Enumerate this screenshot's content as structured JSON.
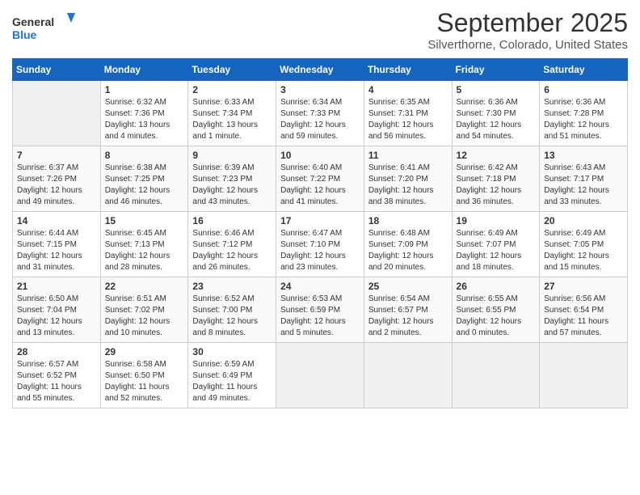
{
  "header": {
    "logo_line1": "General",
    "logo_line2": "Blue",
    "month": "September 2025",
    "location": "Silverthorne, Colorado, United States"
  },
  "weekdays": [
    "Sunday",
    "Monday",
    "Tuesday",
    "Wednesday",
    "Thursday",
    "Friday",
    "Saturday"
  ],
  "weeks": [
    [
      {
        "day": "",
        "sunrise": "",
        "sunset": "",
        "daylight": ""
      },
      {
        "day": "1",
        "sunrise": "Sunrise: 6:32 AM",
        "sunset": "Sunset: 7:36 PM",
        "daylight": "Daylight: 13 hours and 4 minutes."
      },
      {
        "day": "2",
        "sunrise": "Sunrise: 6:33 AM",
        "sunset": "Sunset: 7:34 PM",
        "daylight": "Daylight: 13 hours and 1 minute."
      },
      {
        "day": "3",
        "sunrise": "Sunrise: 6:34 AM",
        "sunset": "Sunset: 7:33 PM",
        "daylight": "Daylight: 12 hours and 59 minutes."
      },
      {
        "day": "4",
        "sunrise": "Sunrise: 6:35 AM",
        "sunset": "Sunset: 7:31 PM",
        "daylight": "Daylight: 12 hours and 56 minutes."
      },
      {
        "day": "5",
        "sunrise": "Sunrise: 6:36 AM",
        "sunset": "Sunset: 7:30 PM",
        "daylight": "Daylight: 12 hours and 54 minutes."
      },
      {
        "day": "6",
        "sunrise": "Sunrise: 6:36 AM",
        "sunset": "Sunset: 7:28 PM",
        "daylight": "Daylight: 12 hours and 51 minutes."
      }
    ],
    [
      {
        "day": "7",
        "sunrise": "Sunrise: 6:37 AM",
        "sunset": "Sunset: 7:26 PM",
        "daylight": "Daylight: 12 hours and 49 minutes."
      },
      {
        "day": "8",
        "sunrise": "Sunrise: 6:38 AM",
        "sunset": "Sunset: 7:25 PM",
        "daylight": "Daylight: 12 hours and 46 minutes."
      },
      {
        "day": "9",
        "sunrise": "Sunrise: 6:39 AM",
        "sunset": "Sunset: 7:23 PM",
        "daylight": "Daylight: 12 hours and 43 minutes."
      },
      {
        "day": "10",
        "sunrise": "Sunrise: 6:40 AM",
        "sunset": "Sunset: 7:22 PM",
        "daylight": "Daylight: 12 hours and 41 minutes."
      },
      {
        "day": "11",
        "sunrise": "Sunrise: 6:41 AM",
        "sunset": "Sunset: 7:20 PM",
        "daylight": "Daylight: 12 hours and 38 minutes."
      },
      {
        "day": "12",
        "sunrise": "Sunrise: 6:42 AM",
        "sunset": "Sunset: 7:18 PM",
        "daylight": "Daylight: 12 hours and 36 minutes."
      },
      {
        "day": "13",
        "sunrise": "Sunrise: 6:43 AM",
        "sunset": "Sunset: 7:17 PM",
        "daylight": "Daylight: 12 hours and 33 minutes."
      }
    ],
    [
      {
        "day": "14",
        "sunrise": "Sunrise: 6:44 AM",
        "sunset": "Sunset: 7:15 PM",
        "daylight": "Daylight: 12 hours and 31 minutes."
      },
      {
        "day": "15",
        "sunrise": "Sunrise: 6:45 AM",
        "sunset": "Sunset: 7:13 PM",
        "daylight": "Daylight: 12 hours and 28 minutes."
      },
      {
        "day": "16",
        "sunrise": "Sunrise: 6:46 AM",
        "sunset": "Sunset: 7:12 PM",
        "daylight": "Daylight: 12 hours and 26 minutes."
      },
      {
        "day": "17",
        "sunrise": "Sunrise: 6:47 AM",
        "sunset": "Sunset: 7:10 PM",
        "daylight": "Daylight: 12 hours and 23 minutes."
      },
      {
        "day": "18",
        "sunrise": "Sunrise: 6:48 AM",
        "sunset": "Sunset: 7:09 PM",
        "daylight": "Daylight: 12 hours and 20 minutes."
      },
      {
        "day": "19",
        "sunrise": "Sunrise: 6:49 AM",
        "sunset": "Sunset: 7:07 PM",
        "daylight": "Daylight: 12 hours and 18 minutes."
      },
      {
        "day": "20",
        "sunrise": "Sunrise: 6:49 AM",
        "sunset": "Sunset: 7:05 PM",
        "daylight": "Daylight: 12 hours and 15 minutes."
      }
    ],
    [
      {
        "day": "21",
        "sunrise": "Sunrise: 6:50 AM",
        "sunset": "Sunset: 7:04 PM",
        "daylight": "Daylight: 12 hours and 13 minutes."
      },
      {
        "day": "22",
        "sunrise": "Sunrise: 6:51 AM",
        "sunset": "Sunset: 7:02 PM",
        "daylight": "Daylight: 12 hours and 10 minutes."
      },
      {
        "day": "23",
        "sunrise": "Sunrise: 6:52 AM",
        "sunset": "Sunset: 7:00 PM",
        "daylight": "Daylight: 12 hours and 8 minutes."
      },
      {
        "day": "24",
        "sunrise": "Sunrise: 6:53 AM",
        "sunset": "Sunset: 6:59 PM",
        "daylight": "Daylight: 12 hours and 5 minutes."
      },
      {
        "day": "25",
        "sunrise": "Sunrise: 6:54 AM",
        "sunset": "Sunset: 6:57 PM",
        "daylight": "Daylight: 12 hours and 2 minutes."
      },
      {
        "day": "26",
        "sunrise": "Sunrise: 6:55 AM",
        "sunset": "Sunset: 6:55 PM",
        "daylight": "Daylight: 12 hours and 0 minutes."
      },
      {
        "day": "27",
        "sunrise": "Sunrise: 6:56 AM",
        "sunset": "Sunset: 6:54 PM",
        "daylight": "Daylight: 11 hours and 57 minutes."
      }
    ],
    [
      {
        "day": "28",
        "sunrise": "Sunrise: 6:57 AM",
        "sunset": "Sunset: 6:52 PM",
        "daylight": "Daylight: 11 hours and 55 minutes."
      },
      {
        "day": "29",
        "sunrise": "Sunrise: 6:58 AM",
        "sunset": "Sunset: 6:50 PM",
        "daylight": "Daylight: 11 hours and 52 minutes."
      },
      {
        "day": "30",
        "sunrise": "Sunrise: 6:59 AM",
        "sunset": "Sunset: 6:49 PM",
        "daylight": "Daylight: 11 hours and 49 minutes."
      },
      {
        "day": "",
        "sunrise": "",
        "sunset": "",
        "daylight": ""
      },
      {
        "day": "",
        "sunrise": "",
        "sunset": "",
        "daylight": ""
      },
      {
        "day": "",
        "sunrise": "",
        "sunset": "",
        "daylight": ""
      },
      {
        "day": "",
        "sunrise": "",
        "sunset": "",
        "daylight": ""
      }
    ]
  ]
}
